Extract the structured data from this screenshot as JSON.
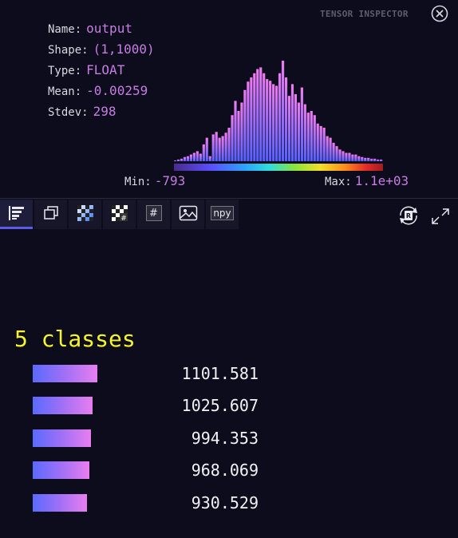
{
  "header": {
    "title": "TENSOR INSPECTOR",
    "close_icon": "close-icon"
  },
  "stats": [
    {
      "label": "Name:",
      "value": "output"
    },
    {
      "label": "Shape:",
      "value": "(1,1000)"
    },
    {
      "label": "Type:",
      "value": "FLOAT"
    },
    {
      "label": "Mean:",
      "value": "-0.00259"
    },
    {
      "label": "Stdev:",
      "value": "298"
    }
  ],
  "range": {
    "min_label": "Min:",
    "min_value": "-793",
    "max_label": "Max:",
    "max_value": "1.1e+03"
  },
  "histogram": {
    "counts": [
      1,
      2,
      3,
      5,
      6,
      8,
      10,
      12,
      9,
      20,
      28,
      6,
      32,
      35,
      28,
      30,
      34,
      40,
      55,
      72,
      60,
      70,
      85,
      95,
      100,
      105,
      110,
      112,
      105,
      98,
      96,
      92,
      90,
      105,
      120,
      100,
      78,
      92,
      80,
      70,
      88,
      68,
      58,
      60,
      55,
      45,
      42,
      40,
      30,
      28,
      22,
      18,
      14,
      12,
      10,
      10,
      8,
      8,
      6,
      5,
      4,
      4,
      3,
      3,
      2,
      2
    ],
    "color_low": "#5560ff",
    "color_high": "#f07cf2"
  },
  "colorbar": {
    "colors": [
      "#4a2a8c",
      "#5a50ff",
      "#2ba3ff",
      "#2fe0d8",
      "#8be33a",
      "#f2e02a",
      "#ff8a1a",
      "#e42a2a",
      "#a01e1e"
    ]
  },
  "toolbar": {
    "buttons": [
      {
        "icon": "bar-list-icon",
        "active": true
      },
      {
        "icon": "copy-icon",
        "active": false
      },
      {
        "icon": "checker-gradient-icon",
        "active": false
      },
      {
        "icon": "checker-hash-icon",
        "active": false
      },
      {
        "icon": "hash-icon",
        "label": "#",
        "active": false
      },
      {
        "icon": "image-icon",
        "active": false
      },
      {
        "icon": "npy-icon",
        "label": "npy",
        "active": false
      }
    ],
    "right": [
      "rotate-icon",
      "expand-icon"
    ]
  },
  "classes": {
    "title": "5 classes",
    "max_value": 1101.581,
    "items": [
      {
        "value": 1101.581,
        "label": "1101.581"
      },
      {
        "value": 1025.607,
        "label": "1025.607"
      },
      {
        "value": 994.353,
        "label": "994.353"
      },
      {
        "value": 968.069,
        "label": "968.069"
      },
      {
        "value": 930.529,
        "label": "930.529"
      }
    ]
  }
}
